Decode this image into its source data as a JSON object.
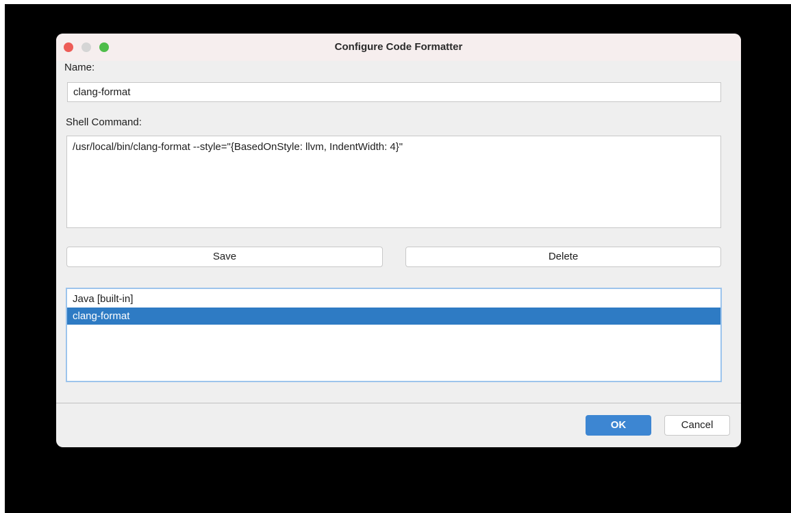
{
  "window": {
    "title": "Configure Code Formatter"
  },
  "form": {
    "name_label": "Name:",
    "name_value": "clang-format",
    "command_label": "Shell Command:",
    "command_value": "/usr/local/bin/clang-format --style=\"{BasedOnStyle: llvm, IndentWidth: 4}\""
  },
  "actions": {
    "save_label": "Save",
    "delete_label": "Delete"
  },
  "formatters": [
    {
      "label": "Java [built-in]",
      "selected": false
    },
    {
      "label": "clang-format",
      "selected": true
    }
  ],
  "footer": {
    "ok_label": "OK",
    "cancel_label": "Cancel"
  },
  "colors": {
    "selection": "#2e7bc4",
    "ok_button": "#3d86d2",
    "close_light": "#ed5c57",
    "minimize_light": "#d5d5d5",
    "zoom_light": "#4fbd4a"
  }
}
